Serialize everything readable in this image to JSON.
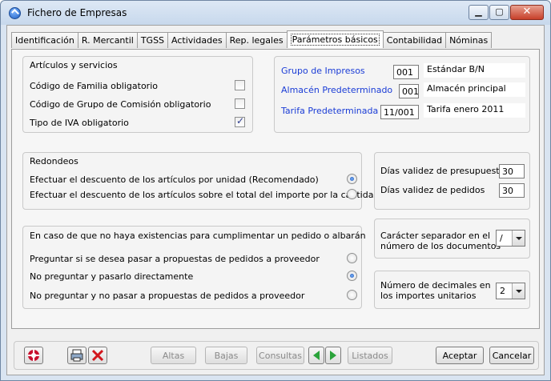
{
  "window": {
    "title": "Fichero de Empresas"
  },
  "tabs": [
    {
      "label": "Identificación"
    },
    {
      "label": "R. Mercantil"
    },
    {
      "label": "TGSS"
    },
    {
      "label": "Actividades"
    },
    {
      "label": "Rep. legales"
    },
    {
      "label": "Parámetros básicos"
    },
    {
      "label": "Contabilidad"
    },
    {
      "label": "Nóminas"
    }
  ],
  "articulos": {
    "title": "Artículos y servicios",
    "items": [
      {
        "label": "Código de Familia obligatorio",
        "checked": false
      },
      {
        "label": "Código de Grupo de Comisión obligatorio",
        "checked": false
      },
      {
        "label": "Tipo de IVA obligatorio",
        "checked": true
      }
    ]
  },
  "grupos": {
    "grupo_impresos": {
      "label": "Grupo de Impresos",
      "code": "001",
      "desc": "Estándar B/N"
    },
    "almacen": {
      "label": "Almacén Predeterminado",
      "code": "001",
      "desc": "Almacén principal"
    },
    "tarifa": {
      "label": "Tarifa Predeterminada",
      "code": "11/001",
      "desc": "Tarifa enero 2011"
    }
  },
  "redondeos": {
    "title": "Redondeos",
    "options": [
      {
        "label": "Efectuar el descuento de los artículos por unidad  (Recomendado)",
        "selected": true
      },
      {
        "label": "Efectuar el descuento de los artículos sobre el total del importe por la cantidad",
        "selected": false
      }
    ]
  },
  "validez": {
    "presupuestos": {
      "label": "Días validez de presupuestos",
      "value": "30"
    },
    "pedidos": {
      "label": "Días validez de pedidos",
      "value": "30"
    }
  },
  "existencias": {
    "title": "En caso de que no haya existencias para cumplimentar un pedido o albarán",
    "options": [
      {
        "label": "Preguntar si se desea pasar a propuestas de pedidos a proveedor",
        "selected": false
      },
      {
        "label": "No preguntar y pasarlo directamente",
        "selected": true
      },
      {
        "label": "No preguntar y no pasar a propuestas de pedidos a proveedor",
        "selected": false
      }
    ]
  },
  "separador": {
    "label1": "Carácter separador en el",
    "label2": "número de los documentos",
    "value": "/"
  },
  "decimales": {
    "label1": "Número de decimales en",
    "label2": "los importes unitarios",
    "value": "2"
  },
  "footer": {
    "altas": "Altas",
    "bajas": "Bajas",
    "consultas": "Consultas",
    "listados": "Listados",
    "aceptar": "Aceptar",
    "cancelar": "Cancelar"
  },
  "icons": {
    "app": "app-logo-icon",
    "help": "help-lifebuoy-icon",
    "print": "printer-icon",
    "delete": "red-x-icon",
    "prev": "green-left-arrow-icon",
    "next": "green-right-arrow-icon"
  }
}
